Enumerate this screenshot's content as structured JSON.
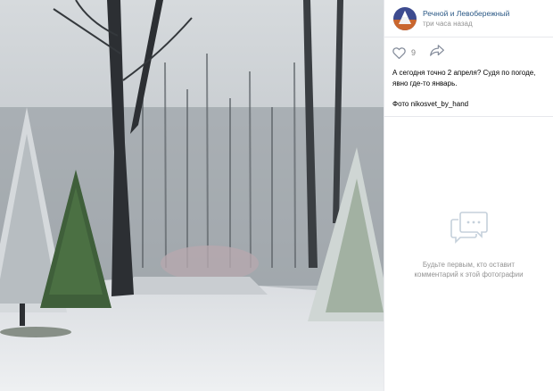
{
  "post": {
    "group_name": "Речной и Левобережный",
    "time": "три часа назад",
    "like_count": "9",
    "text_line1": "А сегодня точно 2 апреля? Судя по погоде,",
    "text_line2": "явно где-то январь.",
    "credit": "Фото nikosvet_by_hand"
  },
  "comments": {
    "empty_line1": "Будьте первым, кто оставит",
    "empty_line2": "комментарий к этой фотографии"
  },
  "icons": {
    "like": "heart-icon",
    "share": "share-icon",
    "empty_comments": "speech-bubble-icon"
  },
  "colors": {
    "link": "#2a5885",
    "muted": "#939393",
    "divider": "#e7e8ec"
  }
}
